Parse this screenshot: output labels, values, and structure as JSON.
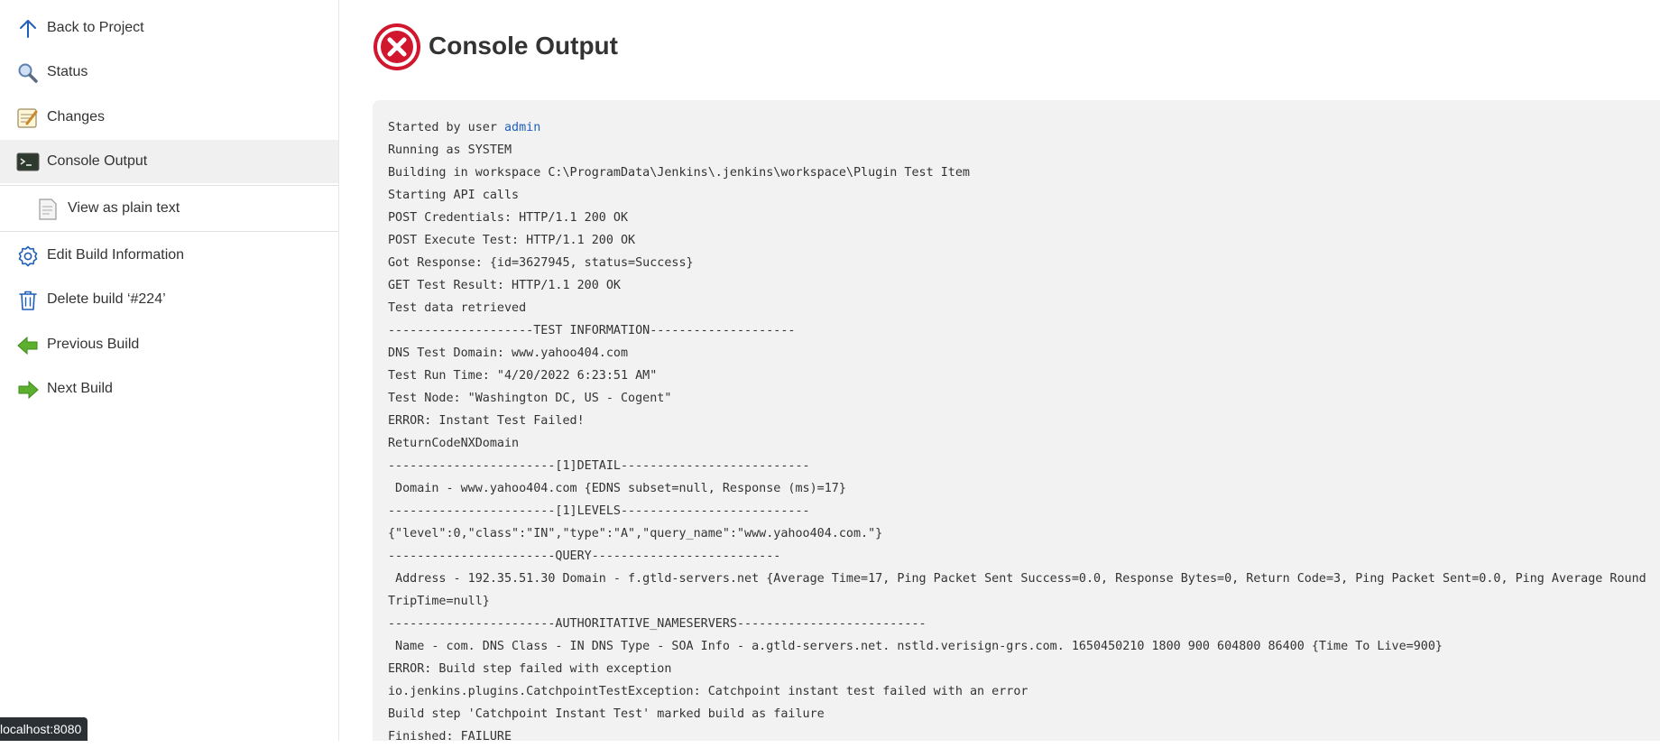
{
  "sidebar": {
    "items": [
      {
        "label": "Back to Project",
        "icon": "arrow-up-icon"
      },
      {
        "label": "Status",
        "icon": "magnifier-icon"
      },
      {
        "label": "Changes",
        "icon": "notepad-icon"
      },
      {
        "label": "Console Output",
        "icon": "terminal-icon"
      },
      {
        "label": "View as plain text",
        "icon": "document-icon"
      },
      {
        "label": "Edit Build Information",
        "icon": "gear-icon"
      },
      {
        "label": "Delete build ‘#224’",
        "icon": "trash-icon"
      },
      {
        "label": "Previous Build",
        "icon": "arrow-left-green-icon"
      },
      {
        "label": "Next Build",
        "icon": "arrow-right-green-icon"
      }
    ]
  },
  "main": {
    "title": "Console Output",
    "status_icon": "failure-x-icon",
    "status_color": "#d0172e"
  },
  "console": {
    "line0_prefix": "Started by user ",
    "line0_user": "admin",
    "lines": [
      "Running as SYSTEM",
      "Building in workspace C:\\ProgramData\\Jenkins\\.jenkins\\workspace\\Plugin Test Item",
      "Starting API calls",
      "POST Credentials: HTTP/1.1 200 OK",
      "POST Execute Test: HTTP/1.1 200 OK",
      "Got Response: {id=3627945, status=Success}",
      "GET Test Result: HTTP/1.1 200 OK",
      "Test data retrieved",
      "--------------------TEST INFORMATION--------------------",
      "DNS Test Domain: www.yahoo404.com",
      "Test Run Time: \"4/20/2022 6:23:51 AM\"",
      "Test Node: \"Washington DC, US - Cogent\"",
      "ERROR: Instant Test Failed!",
      "ReturnCodeNXDomain",
      "-----------------------[1]DETAIL--------------------------",
      " Domain - www.yahoo404.com {EDNS subset=null, Response (ms)=17}",
      "-----------------------[1]LEVELS--------------------------",
      "{\"level\":0,\"class\":\"IN\",\"type\":\"A\",\"query_name\":\"www.yahoo404.com.\"}",
      "-----------------------QUERY--------------------------",
      " Address - 192.35.51.30 Domain - f.gtld-servers.net {Average Time=17, Ping Packet Sent Success=0.0, Response Bytes=0, Return Code=3, Ping Packet Sent=0.0, Ping Average Round TripTime=null}",
      "-----------------------AUTHORITATIVE_NAMESERVERS--------------------------",
      " Name - com. DNS Class - IN DNS Type - SOA Info - a.gtld-servers.net. nstld.verisign-grs.com. 1650450210 1800 900 604800 86400 {Time To Live=900}",
      "ERROR: Build step failed with exception",
      "io.jenkins.plugins.CatchpointTestException: Catchpoint instant test failed with an error",
      "Build step 'Catchpoint Instant Test' marked build as failure",
      "Finished: FAILURE"
    ]
  },
  "statusbar": {
    "url": "localhost:8080"
  }
}
